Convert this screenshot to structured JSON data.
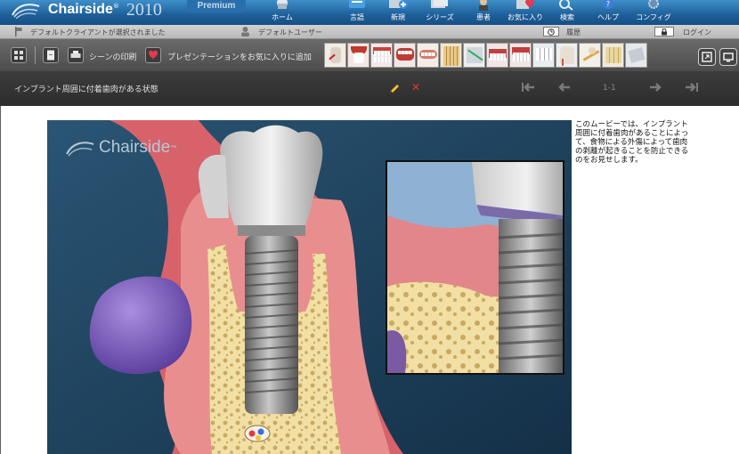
{
  "app": {
    "logo_text": "Chairside",
    "logo_year": "2010",
    "edition": "Premium"
  },
  "nav": [
    {
      "label": "ホーム",
      "icon": "home-icon"
    },
    {
      "label": "言語",
      "icon": "language-icon"
    },
    {
      "label": "新規",
      "icon": "new-icon"
    },
    {
      "label": "シリーズ",
      "icon": "series-icon"
    },
    {
      "label": "患者",
      "icon": "patient-icon"
    },
    {
      "label": "お気に入り",
      "icon": "favorites-icon"
    },
    {
      "label": "検索",
      "icon": "search-icon"
    },
    {
      "label": "ヘルプ",
      "icon": "help-icon"
    },
    {
      "label": "コンフィグ",
      "icon": "config-icon"
    }
  ],
  "status": {
    "client": "デフォルトクライアントが選択されました",
    "user": "デフォルトユーザー",
    "history": "履歴",
    "login": "ログイン"
  },
  "toolbar": {
    "print_scene": "シーンの印刷",
    "add_favorite": "プレゼンテーションをお気に入りに追加"
  },
  "scene": {
    "title": "インプラント周囲に付着歯肉がある状態",
    "page": "1-1",
    "watermark": "Chairside",
    "description": "このムービーでは、インプラント周囲に付着歯肉があることによって、食物による外傷によって歯肉の剥離が起きることを防止できるのをお見せします。"
  },
  "colors": {
    "header_blue": "#1e5f99",
    "toolbar_gray": "#555555",
    "titlebar_dark": "#333333",
    "scene_bg": "#1d3c57",
    "accent_red": "#e53935"
  }
}
